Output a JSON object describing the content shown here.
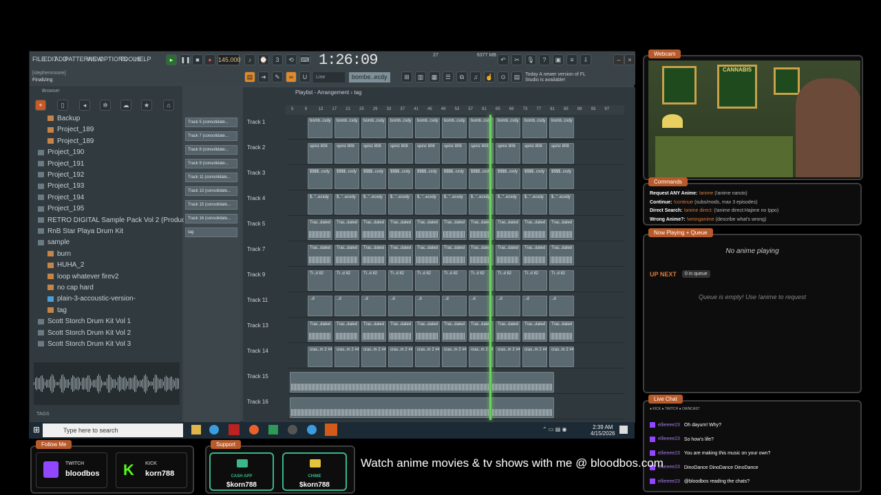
{
  "fl": {
    "menu": [
      "FILE",
      "EDIT",
      "ADD",
      "PATTERNS",
      "VIEW",
      "OPTIONS",
      "TOOLS",
      "HELP"
    ],
    "hint_user": "[stephenmoore]",
    "hint_status": "Finalizing",
    "tempo": "145.000",
    "time": "1:26:09",
    "mem_a": "27",
    "mem_b": "6377 MB",
    "news": "Today  A newer version of FL Studio is available!",
    "snap": "Line",
    "pattern": "bombe..ecdy",
    "browser_title": "Browser",
    "playlist_title": "Playlist - Arrangement › tag"
  },
  "browser_items": [
    {
      "label": "Backup",
      "kind": "fold-o",
      "indent": 1
    },
    {
      "label": "Project_189",
      "kind": "fold-o",
      "indent": 1
    },
    {
      "label": "Project_189",
      "kind": "fold-o",
      "indent": 1
    },
    {
      "label": "Project_190",
      "kind": "fold",
      "indent": 0
    },
    {
      "label": "Project_191",
      "kind": "fold",
      "indent": 0
    },
    {
      "label": "Project_192",
      "kind": "fold",
      "indent": 0
    },
    {
      "label": "Project_193",
      "kind": "fold",
      "indent": 0
    },
    {
      "label": "Project_194",
      "kind": "fold",
      "indent": 0
    },
    {
      "label": "Project_195",
      "kind": "fold",
      "indent": 0
    },
    {
      "label": "RETRO DIGITAL Sample Pack Vol 2 (Producergrind)",
      "kind": "fold",
      "indent": 0
    },
    {
      "label": "RnB Star Playa Drum Kit",
      "kind": "fold",
      "indent": 0
    },
    {
      "label": "sample",
      "kind": "fold",
      "indent": 0
    },
    {
      "label": "burn",
      "kind": "fold-o",
      "indent": 1
    },
    {
      "label": "HUHA_2",
      "kind": "fold-o",
      "indent": 1
    },
    {
      "label": "loop whatever firev2",
      "kind": "fold-o",
      "indent": 1
    },
    {
      "label": "no cap hard",
      "kind": "fold-o",
      "indent": 1
    },
    {
      "label": "plain-3-accoustic-version-",
      "kind": "fold-b",
      "indent": 1
    },
    {
      "label": "tag",
      "kind": "fold-o",
      "indent": 1
    },
    {
      "label": "Scott Storch Drum Kit Vol 1",
      "kind": "fold",
      "indent": 0
    },
    {
      "label": "Scott Storch Drum Kit Vol 2",
      "kind": "fold",
      "indent": 0
    },
    {
      "label": "Scott Storch Drum Kit Vol 3",
      "kind": "fold",
      "indent": 0
    }
  ],
  "browser_tags": "TAGS",
  "picker": [
    "Track 5 (consolidate...",
    "Track 7 (consolidate...",
    "Track 8 (consolidate...",
    "Track 9 (consolidate...",
    "Track 11 (consolidate...",
    "Track 13 (consolidate...",
    "Track 15 (consolidate...",
    "Track 16 (consolidate...",
    "tag"
  ],
  "ruler": [
    "5",
    "9",
    "13",
    "17",
    "21",
    "25",
    "29",
    "33",
    "37",
    "41",
    "45",
    "49",
    "53",
    "57",
    "61",
    "65",
    "69",
    "73",
    "77",
    "81",
    "85",
    "89",
    "93",
    "97"
  ],
  "tracks": [
    {
      "label": "Track 1",
      "clip": "bomb..cxdy",
      "wave": false
    },
    {
      "label": "Track 2",
      "clip": "spinz 808",
      "wave": false
    },
    {
      "label": "Track 3",
      "clip": "$$$$..cxdy",
      "wave": false
    },
    {
      "label": "Track 4",
      "clip": "$..\"..ecxdy",
      "wave": false
    },
    {
      "label": "Track 5",
      "clip": "Trac..dated",
      "wave": true
    },
    {
      "label": "Track 7",
      "clip": "Trac..dated",
      "wave": true
    },
    {
      "label": "Track 9",
      "clip": "Tr..d 82",
      "wave": false
    },
    {
      "label": "Track 11",
      "clip": "..d",
      "wave": false
    },
    {
      "label": "Track 13",
      "clip": "Trac..dated",
      "wave": true
    },
    {
      "label": "Track 14",
      "clip": "cras..m 2 #4",
      "wave": false
    },
    {
      "label": "Track 15",
      "clip": "",
      "wave": true
    },
    {
      "label": "Track 16",
      "clip": "",
      "wave": true
    }
  ],
  "taskbar": {
    "search_placeholder": "Type here to search",
    "time": "2:39 AM",
    "date": "4/15/2026"
  },
  "webcam_tab": "Webcam",
  "webcam_poster": "CANNABIS",
  "commands": {
    "tab": "Commands",
    "rows": [
      {
        "label": "Request ANY Anime:",
        "cmd": "!anime",
        "desc": "(!anime naruto)"
      },
      {
        "label": "Continue:",
        "cmd": "!continue",
        "desc": "(subs/mods, max 3 episodes)"
      },
      {
        "label": "Direct Search:",
        "cmd": "!anime direct:",
        "desc": "(!anime direct:Hajime no Ippo)"
      },
      {
        "label": "Wrong Anime?:",
        "cmd": "!wronganime",
        "desc": "(describe what's wrong)"
      }
    ]
  },
  "now_playing": {
    "tab": "Now Playing + Queue",
    "empty": "No anime playing",
    "up_next": "UP NEXT",
    "queue_count": "0 in queue",
    "queue_empty": "Queue is empty! Use !anime to request"
  },
  "chat": {
    "tab": "Live Chat",
    "sources": "● KICK  ● TWITCH  ● OWNCAST",
    "messages": [
      {
        "user": "ellieeee23",
        "text": "Oh dayum! Why?"
      },
      {
        "user": "ellieeee23",
        "text": "So how's life?"
      },
      {
        "user": "ellieeee23",
        "text": "You are making this music on your own?"
      },
      {
        "user": "ellieeee23",
        "text": "DinoDance DinoDance DinoDance"
      },
      {
        "user": "ellieeee23",
        "text": "@bloodbos reading the chats?"
      }
    ]
  },
  "follow": {
    "tab": "Follow Me",
    "twitch_label": "TWITCH",
    "twitch_user": "bloodbos",
    "kick_label": "KICK",
    "kick_user": "korn788"
  },
  "support": {
    "tab": "Support",
    "cashapp_label": "CASH APP",
    "cashapp_user": "$korn788",
    "chime_label": "CHIME",
    "chime_user": "$korn788"
  },
  "ticker": "Watch anime movies & tv shows with me @ bloodbos.com",
  "colors": {
    "accent": "#b85a2a",
    "playhead": "#6bd25b",
    "support": "#39b88a",
    "twitch": "#9146ff",
    "kick": "#53fc18"
  }
}
